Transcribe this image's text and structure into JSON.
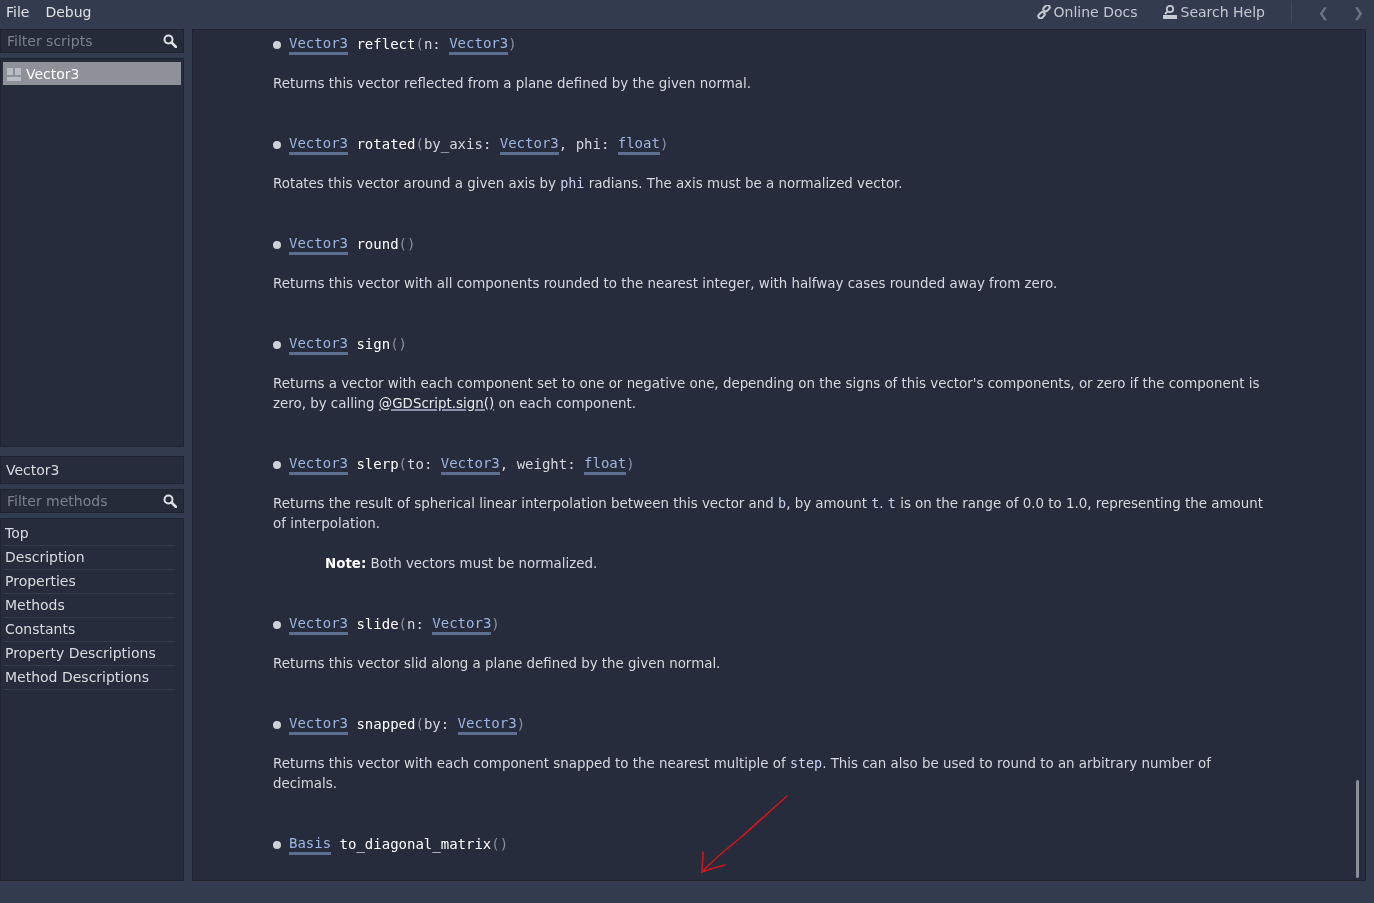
{
  "menu": [
    "File",
    "Debug"
  ],
  "toolbar": {
    "online_docs": "Online Docs",
    "search_help": "Search Help",
    "back": "❮",
    "forward": "❯"
  },
  "scripts": {
    "placeholder": "Filter scripts",
    "items": [
      {
        "label": "Vector3",
        "selected": true
      }
    ]
  },
  "class_label": "Vector3",
  "methods_filter": {
    "placeholder": "Filter methods"
  },
  "outline": [
    "Top",
    "Description",
    "Properties",
    "Methods",
    "Constants",
    "Property Descriptions",
    "Method Descriptions"
  ],
  "methods": [
    {
      "signature": [
        {
          "kind": "type",
          "text": "Vector3"
        },
        {
          "kind": "name",
          "text": "reflect"
        },
        {
          "kind": "punct",
          "text": "("
        },
        {
          "kind": "param",
          "text": "n:"
        },
        {
          "kind": "type",
          "text": "Vector3"
        },
        {
          "kind": "punct",
          "text": ")"
        }
      ],
      "description": [
        {
          "kind": "plain",
          "text": "Returns this vector reflected from a plane defined by the given normal."
        }
      ]
    },
    {
      "signature": [
        {
          "kind": "type",
          "text": "Vector3"
        },
        {
          "kind": "name",
          "text": "rotated"
        },
        {
          "kind": "punct",
          "text": "("
        },
        {
          "kind": "param",
          "text": "by_axis:"
        },
        {
          "kind": "type",
          "text": "Vector3"
        },
        {
          "kind": "comma",
          "text": ","
        },
        {
          "kind": "param",
          "text": "phi:"
        },
        {
          "kind": "type",
          "text": "float"
        },
        {
          "kind": "punct",
          "text": ")"
        }
      ],
      "description": [
        {
          "kind": "plain",
          "text": "Rotates this vector around a given axis by "
        },
        {
          "kind": "code",
          "text": "phi"
        },
        {
          "kind": "plain",
          "text": " radians. The axis must be a normalized vector."
        }
      ]
    },
    {
      "signature": [
        {
          "kind": "type",
          "text": "Vector3"
        },
        {
          "kind": "name",
          "text": "round"
        },
        {
          "kind": "punct",
          "text": "("
        },
        {
          "kind": "punct",
          "text": ")"
        }
      ],
      "description": [
        {
          "kind": "plain",
          "text": "Returns this vector with all components rounded to the nearest integer, with halfway cases rounded away from zero."
        }
      ]
    },
    {
      "signature": [
        {
          "kind": "type",
          "text": "Vector3"
        },
        {
          "kind": "name",
          "text": "sign"
        },
        {
          "kind": "punct",
          "text": "("
        },
        {
          "kind": "punct",
          "text": ")"
        }
      ],
      "description": [
        {
          "kind": "plain",
          "text": "Returns a vector with each component set to one or negative one, depending on the signs of this vector's components, or zero if the component is zero, by calling "
        },
        {
          "kind": "link",
          "text": "@GDScript.sign()"
        },
        {
          "kind": "plain",
          "text": " on each component."
        }
      ]
    },
    {
      "signature": [
        {
          "kind": "type",
          "text": "Vector3"
        },
        {
          "kind": "name",
          "text": "slerp"
        },
        {
          "kind": "punct",
          "text": "("
        },
        {
          "kind": "param",
          "text": "to:"
        },
        {
          "kind": "type",
          "text": "Vector3"
        },
        {
          "kind": "comma",
          "text": ","
        },
        {
          "kind": "param",
          "text": "weight:"
        },
        {
          "kind": "type",
          "text": "float"
        },
        {
          "kind": "punct",
          "text": ")"
        }
      ],
      "description": [
        {
          "kind": "plain",
          "text": "Returns the result of spherical linear interpolation between this vector and "
        },
        {
          "kind": "code",
          "text": "b"
        },
        {
          "kind": "plain",
          "text": ", by amount "
        },
        {
          "kind": "code",
          "text": "t"
        },
        {
          "kind": "plain",
          "text": ". "
        },
        {
          "kind": "code",
          "text": "t"
        },
        {
          "kind": "plain",
          "text": " is on the range of 0.0 to 1.0, representing the amount of interpolation."
        }
      ],
      "note": {
        "label": "Note:",
        "text": "Both vectors must be normalized."
      }
    },
    {
      "signature": [
        {
          "kind": "type",
          "text": "Vector3"
        },
        {
          "kind": "name",
          "text": "slide"
        },
        {
          "kind": "punct",
          "text": "("
        },
        {
          "kind": "param",
          "text": "n:"
        },
        {
          "kind": "type",
          "text": "Vector3"
        },
        {
          "kind": "punct",
          "text": ")"
        }
      ],
      "description": [
        {
          "kind": "plain",
          "text": "Returns this vector slid along a plane defined by the given normal."
        }
      ]
    },
    {
      "signature": [
        {
          "kind": "type",
          "text": "Vector3"
        },
        {
          "kind": "name",
          "text": "snapped"
        },
        {
          "kind": "punct",
          "text": "("
        },
        {
          "kind": "param",
          "text": "by:"
        },
        {
          "kind": "type",
          "text": "Vector3"
        },
        {
          "kind": "punct",
          "text": ")"
        }
      ],
      "description": [
        {
          "kind": "plain",
          "text": "Returns this vector with each component snapped to the nearest multiple of "
        },
        {
          "kind": "code",
          "text": "step"
        },
        {
          "kind": "plain",
          "text": ". This can also be used to round to an arbitrary number of decimals."
        }
      ]
    },
    {
      "signature": [
        {
          "kind": "type",
          "text": "Basis"
        },
        {
          "kind": "name",
          "text": "to_diagonal_matrix"
        },
        {
          "kind": "punct",
          "text": "("
        },
        {
          "kind": "punct",
          "text": ")"
        }
      ]
    }
  ]
}
